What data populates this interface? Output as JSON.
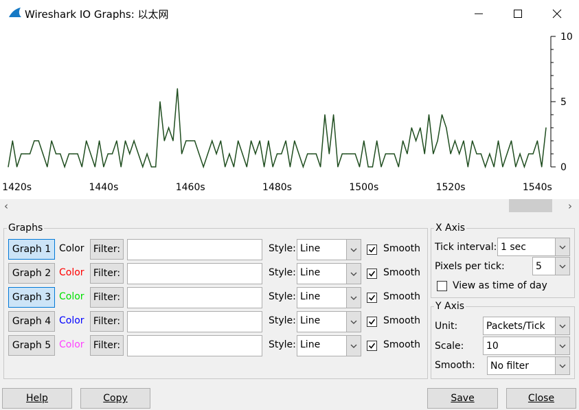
{
  "window": {
    "title": "Wireshark IO Graphs: 以太网"
  },
  "colors": {
    "plot_line": "#1f4d1f",
    "graph1": "#000000",
    "graph2": "#ff0000",
    "graph3": "#00e000",
    "graph4": "#0000ff",
    "graph5": "#ff40ff"
  },
  "chart_data": {
    "type": "line",
    "x_ticks": [
      "1420s",
      "1440s",
      "1460s",
      "1480s",
      "1500s",
      "1520s",
      "1540s"
    ],
    "x_tick_values": [
      1420,
      1440,
      1460,
      1480,
      1500,
      1520,
      1540
    ],
    "y_ticks": [
      "10",
      "5",
      "0"
    ],
    "y_tick_values": [
      10,
      5,
      0
    ],
    "xlim": [
      1418,
      1542
    ],
    "ylim": [
      0,
      10
    ],
    "series": [
      {
        "x_start": 1418,
        "x_step": 1,
        "values": [
          0,
          2,
          0,
          1,
          1,
          1,
          2,
          2,
          1,
          0,
          2,
          1,
          1,
          0,
          1,
          1,
          1,
          0,
          2,
          1,
          0,
          2,
          0,
          1,
          1,
          2,
          0,
          2,
          1,
          2,
          1,
          0,
          1,
          0,
          0,
          5,
          2,
          3,
          2,
          6,
          1,
          2,
          2,
          2,
          1,
          0,
          1,
          2,
          1,
          2,
          0,
          1,
          0,
          2,
          1,
          0,
          2,
          1,
          2,
          0,
          2,
          0,
          1,
          1,
          2,
          0,
          2,
          1,
          0,
          1,
          1,
          1,
          0,
          4,
          1,
          4,
          0,
          1,
          1,
          1,
          1,
          0,
          2,
          0,
          0,
          2,
          0,
          1,
          1,
          1,
          0,
          2,
          1,
          3,
          2,
          3,
          1,
          4,
          1,
          2,
          4,
          3,
          1,
          2,
          1,
          2,
          0,
          2,
          1,
          1,
          0,
          1,
          0,
          2,
          0,
          1,
          2,
          0,
          1,
          0,
          1,
          1,
          2,
          0,
          3
        ]
      }
    ]
  },
  "graphs_group": {
    "legend": "Graphs",
    "rows": [
      {
        "graph": "Graph 1",
        "color": "Color",
        "filter": "Filter:",
        "filter_value": "",
        "style_label": "Style:",
        "style": "Line",
        "smooth": "Smooth"
      },
      {
        "graph": "Graph 2",
        "color": "Color",
        "filter": "Filter:",
        "filter_value": "",
        "style_label": "Style:",
        "style": "Line",
        "smooth": "Smooth"
      },
      {
        "graph": "Graph 3",
        "color": "Color",
        "filter": "Filter:",
        "filter_value": "",
        "style_label": "Style:",
        "style": "Line",
        "smooth": "Smooth"
      },
      {
        "graph": "Graph 4",
        "color": "Color",
        "filter": "Filter:",
        "filter_value": "",
        "style_label": "Style:",
        "style": "Line",
        "smooth": "Smooth"
      },
      {
        "graph": "Graph 5",
        "color": "Color",
        "filter": "Filter:",
        "filter_value": "",
        "style_label": "Style:",
        "style": "Line",
        "smooth": "Smooth"
      }
    ]
  },
  "x_axis": {
    "legend": "X Axis",
    "tick_interval_label": "Tick interval:",
    "tick_interval": "1 sec",
    "pixels_label": "Pixels per tick:",
    "pixels": "5",
    "time_of_day": "View as time of day"
  },
  "y_axis": {
    "legend": "Y Axis",
    "unit_label": "Unit:",
    "unit": "Packets/Tick",
    "scale_label": "Scale:",
    "scale": "10",
    "smooth_label": "Smooth:",
    "smooth": "No filter"
  },
  "footer": {
    "help": "Help",
    "copy": "Copy",
    "save": "Save",
    "close": "Close"
  }
}
